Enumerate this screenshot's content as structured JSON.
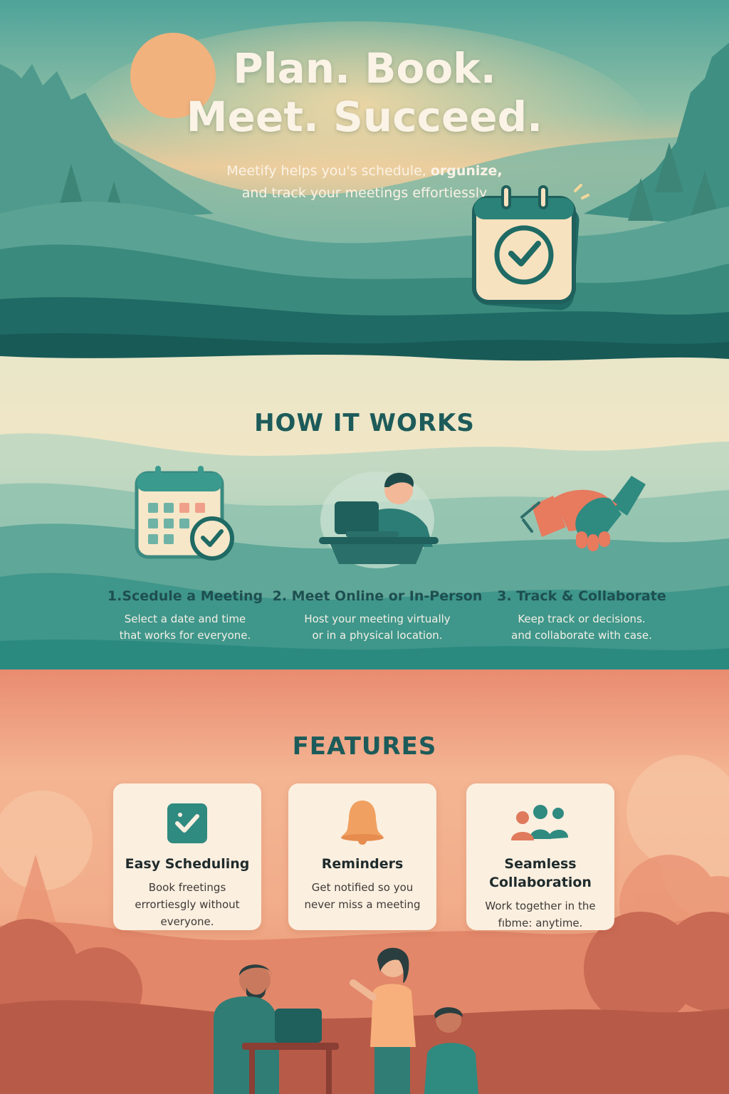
{
  "hero": {
    "title_line1": "Plan. Book.",
    "title_line2": "Meet. Succeed.",
    "subtitle_part1": "Meetify helps you's schedule, ",
    "subtitle_bold1": "orgunize,",
    "subtitle_line2": "and track your meetings effortiessly",
    "icon": "calendar-check-icon"
  },
  "how_it_works": {
    "title": "HOW IT WORKS",
    "steps": [
      {
        "title": "1.Scedule a Meeting",
        "desc_line1": "Select a date and time",
        "desc_line2": "that works for everyone.",
        "icon": "calendar-icon"
      },
      {
        "title": "2. Meet Online or In-Person",
        "desc_line1": "Host your meeting virtually",
        "desc_line2": "or in a physical location.",
        "icon": "person-laptop-icon"
      },
      {
        "title": "3. Track & Collaborate",
        "desc_line1": "Keep track or decisions.",
        "desc_line2": "and collaborate with case.",
        "icon": "handshake-icon"
      }
    ]
  },
  "features": {
    "title": "FEATURES",
    "cards": [
      {
        "title": "Easy Scheduling",
        "desc_line1": "Book freetings",
        "desc_line2": "errortiesgly without",
        "desc_line3": "everyone.",
        "icon": "check-square-icon"
      },
      {
        "title": "Reminders",
        "desc_line1": "Get notified so you",
        "desc_line2": "never miss a meeting",
        "icon": "bell-icon"
      },
      {
        "title_line1": "Seamless",
        "title_line2": "Collaboration",
        "desc_line1": "Work together in the",
        "desc_line2": "fıbme: anytime.",
        "icon": "team-icon"
      }
    ]
  },
  "colors": {
    "teal_dark": "#1d5b5a",
    "teal": "#2f8a80",
    "cream": "#fbefe0",
    "coral": "#e98c70",
    "orange": "#f0a060"
  }
}
